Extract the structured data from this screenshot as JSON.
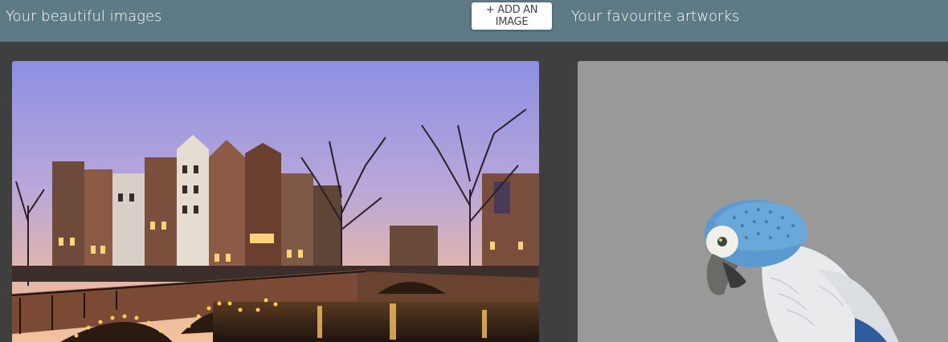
{
  "header": {
    "left_title": "Your beautiful images",
    "add_button_label": "+ ADD AN IMAGE",
    "right_title": "Your favourite artworks"
  },
  "gallery": {
    "left_image": "photo of Amsterdam canal at dusk with illuminated bridge",
    "right_image": "porcelain parrot figurine on grey background"
  },
  "colors": {
    "header_bg": "#5e7a86",
    "page_bg": "#3f3f3f",
    "button_bg": "#ffffff",
    "artwork_bg": "#999999"
  }
}
